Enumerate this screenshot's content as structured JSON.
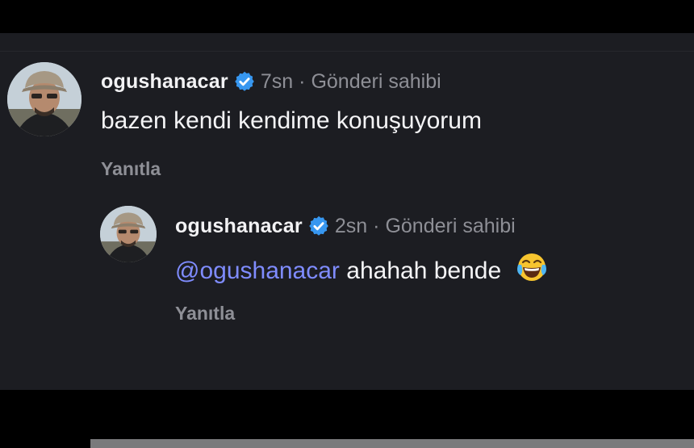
{
  "comments": [
    {
      "username": "ogushanacar",
      "time": "7sn",
      "separator": "·",
      "author_label": "Gönderi sahibi",
      "text": "bazen kendi kendime konuşuyorum",
      "reply_label": "Yanıtla"
    }
  ],
  "replies": [
    {
      "username": "ogushanacar",
      "time": "2sn",
      "separator": "·",
      "author_label": "Gönderi sahibi",
      "mention": "@ogushanacar",
      "text": "ahahah bende",
      "emoji_name": "face-with-tears-of-joy",
      "emoji": "😂",
      "reply_label": "Yanıtla"
    }
  ],
  "colors": {
    "panel_background": "#1c1d22",
    "verified_badge": "#3797f0",
    "mention": "#7f8cff",
    "secondary_text": "#8e8f96",
    "primary_text": "#f2f2f4"
  },
  "icons": {
    "verified": "verified-badge-icon"
  }
}
